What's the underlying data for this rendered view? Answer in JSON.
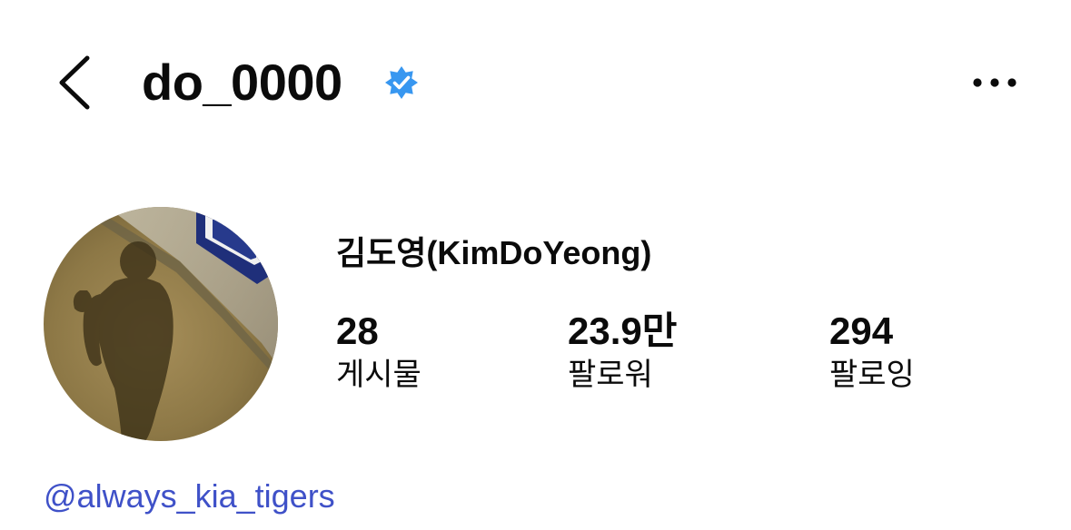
{
  "header": {
    "username": "do_0000",
    "back_icon": "chevron-left-icon",
    "verified_icon": "verified-badge-icon",
    "more_icon": "more-horizontal-icon"
  },
  "profile": {
    "display_name": "김도영(KimDoYeong)",
    "avatar": "shadow-photo-avatar",
    "stats": {
      "posts": {
        "value": "28",
        "label": "게시물"
      },
      "followers": {
        "value": "23.9만",
        "label": "팔로워"
      },
      "following": {
        "value": "294",
        "label": "팔로잉"
      }
    },
    "link_text": "@always_kia_tigers"
  },
  "colors": {
    "verified": "#3897f0",
    "link": "#3f51c8",
    "text": "#0b0b0b",
    "background": "#ffffff"
  }
}
